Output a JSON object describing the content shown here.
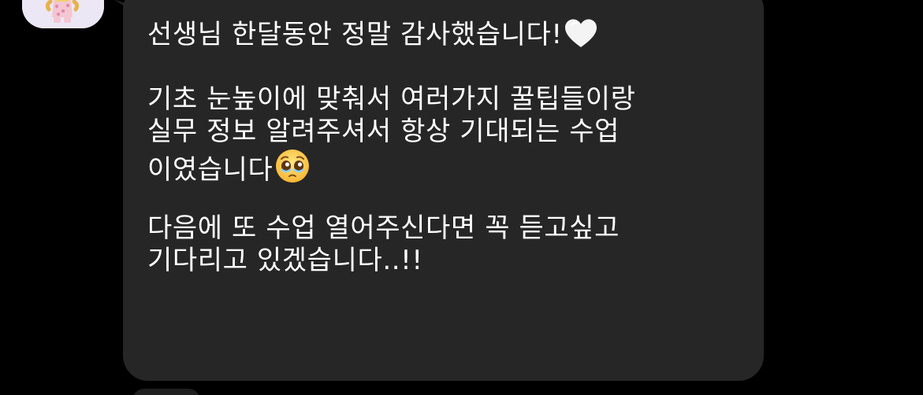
{
  "message": {
    "lines": [
      "선생님 한달동안 정말 감사했습니다!",
      "",
      "기초 눈높이에 맞춰서 여러가지 꿀팁들이랑",
      "실무 정보 알려주셔서 항상 기대되는 수업",
      "이였습니다",
      "",
      "다음에 또 수업 열어주신다면 꼭 듣고싶고",
      "기다리고 있겠습니다..!!"
    ],
    "emoji": {
      "line1": "white-heart-icon",
      "line5": "pleading-face-icon"
    }
  },
  "colors": {
    "background": "#000000",
    "bubble": "#262626",
    "text": "#ffffff"
  }
}
